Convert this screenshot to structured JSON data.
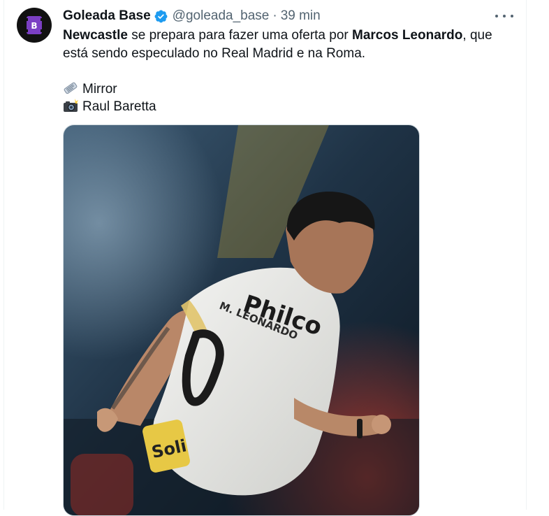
{
  "tweet": {
    "display_name": "Goleada Base",
    "handle": "@goleada_base",
    "separator": "·",
    "time": "39 min",
    "avatar_letter": "B",
    "text_part1": "Newcastle",
    "text_part2": " se prepara para fazer uma oferta por ",
    "text_part3": "Marcos Leonardo",
    "text_part4": ", que está sendo especulado no Real Madrid e na Roma.",
    "source_line": "Mirror",
    "photo_line": "Raul Baretta",
    "source_icon": "newspaper-emoji",
    "photo_icon": "camera-flash-emoji",
    "shirt_text": "Philco",
    "shirt_name": "M. LEONARDO",
    "sponsor_text": "Soli"
  },
  "colors": {
    "text_primary": "#0f1419",
    "text_secondary": "#536471",
    "verified_blue": "#1d9bf0",
    "avatar_bg": "#111111",
    "avatar_accent": "#7b3fc4"
  }
}
